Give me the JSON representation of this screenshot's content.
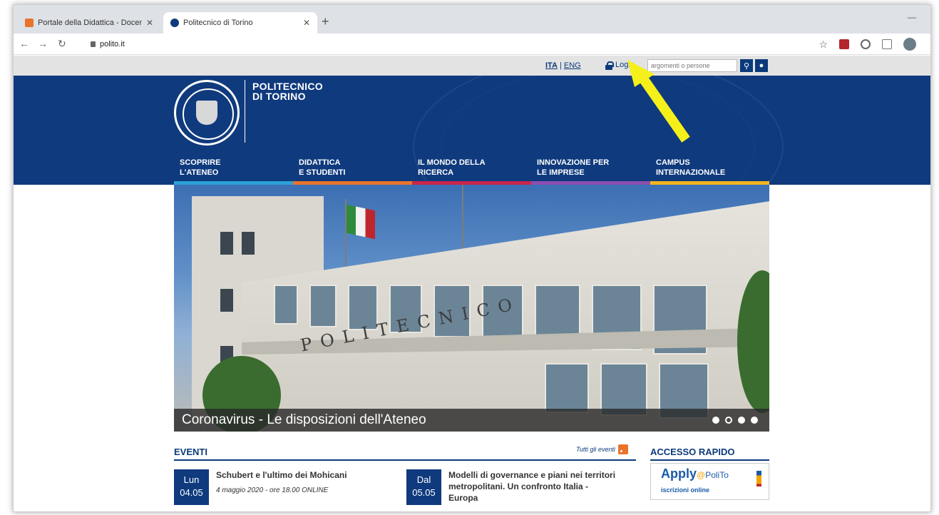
{
  "browser": {
    "tabs": [
      {
        "title": "Portale della Didattica - Docente",
        "close": "✕"
      },
      {
        "title": "Politecnico di Torino",
        "close": "✕"
      }
    ],
    "new_tab": "+",
    "url": "polito.it"
  },
  "site": {
    "lang_ita": "ITA",
    "lang_sep": "|",
    "lang_eng": "ENG",
    "login": "Login",
    "search_placeholder": "argomenti o persone",
    "logo_line1": "POLITECNICO",
    "logo_line2": "DI TORINO",
    "menu": [
      {
        "line1": "SCOPRIRE",
        "line2": "L'ATENEO",
        "color": "#2ba3d8"
      },
      {
        "line1": "DIDATTICA",
        "line2": "E STUDENTI",
        "color": "#e8742c"
      },
      {
        "line1": "IL MONDO DELLA",
        "line2": "RICERCA",
        "color": "#c8264b"
      },
      {
        "line1": "INNOVAZIONE PER",
        "line2": "LE IMPRESE",
        "color": "#8a4fb0"
      },
      {
        "line1": "CAMPUS",
        "line2": "INTERNAZIONALE",
        "color": "#f2b51f"
      }
    ],
    "hero_caption": "Coronavirus - Le disposizioni dell'Ateneo",
    "engraving": "POLITECNICO"
  },
  "eventi": {
    "title": "EVENTI",
    "all_link": "Tutti gli eventi",
    "items": [
      {
        "day": "Lun",
        "date": "04.05",
        "title": "Schubert e l'ultimo dei Mohicani",
        "subtitle": "4 maggio 2020 - ore 18.00 ONLINE"
      },
      {
        "day": "Dal",
        "date": "05.05",
        "title": "Modelli di governance e piani nei territori metropolitani. Un confronto Italia - Europa",
        "subtitle": ""
      }
    ]
  },
  "accesso": {
    "title": "ACCESSO RAPIDO",
    "apply_main": "Apply",
    "apply_e": "@",
    "apply_polito": "PoliTo",
    "apply_sub": "iscrizioni online"
  },
  "colors": {
    "brand_blue": "#0f3a7d",
    "annotation_arrow": "#f5f01a"
  }
}
